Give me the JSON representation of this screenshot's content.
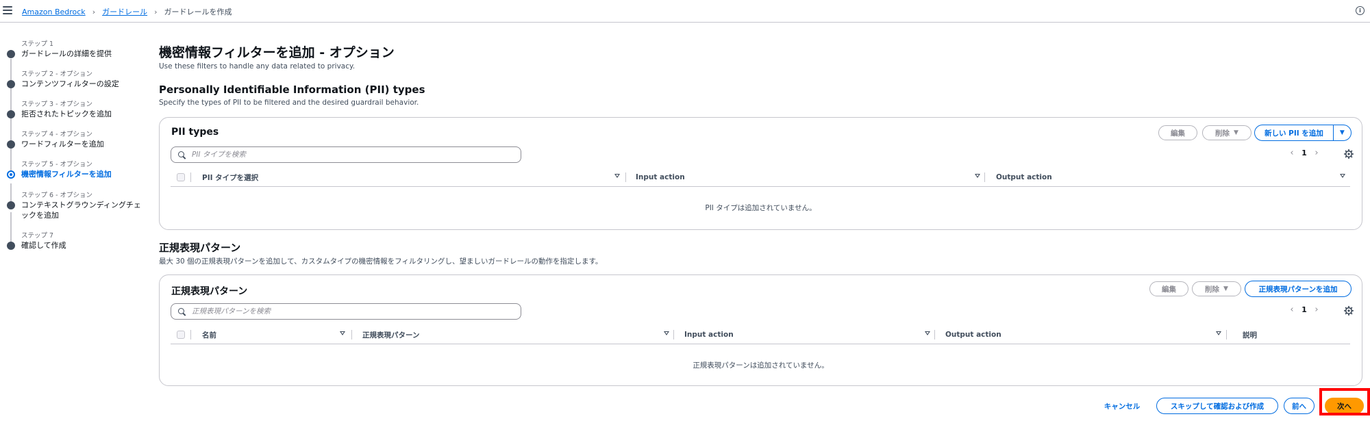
{
  "breadcrumb": {
    "items": [
      "Amazon Bedrock",
      "ガードレール"
    ],
    "current": "ガードレールを作成"
  },
  "steps": [
    {
      "num": "ステップ 1",
      "title": "ガードレールの詳細を提供",
      "active": false
    },
    {
      "num": "ステップ 2 - オプション",
      "title": "コンテンツフィルターの設定",
      "active": false
    },
    {
      "num": "ステップ 3 - オプション",
      "title": "拒否されたトピックを追加",
      "active": false
    },
    {
      "num": "ステップ 4 - オプション",
      "title": "ワードフィルターを追加",
      "active": false
    },
    {
      "num": "ステップ 5 - オプション",
      "title": "機密情報フィルターを追加",
      "active": true
    },
    {
      "num": "ステップ 6 - オプション",
      "title": "コンテキストグラウンディングチェックを追加",
      "active": false
    },
    {
      "num": "ステップ 7",
      "title": "確認して作成",
      "active": false
    }
  ],
  "main": {
    "title": "機密情報フィルターを追加 - オプション",
    "description": "Use these filters to handle any data related to privacy."
  },
  "pii": {
    "section_title": "Personally Identifiable Information (PII) types",
    "section_description": "Specify the types of PII to be filtered and the desired guardrail behavior.",
    "container_title": "PII types",
    "edit_label": "編集",
    "delete_label": "削除",
    "add_label": "新しい PII を追加",
    "search_placeholder": "PII タイプを検索",
    "page": "1",
    "columns": [
      "PII タイプを選択",
      "Input action",
      "Output action"
    ],
    "empty_text": "PII タイプは追加されていません。"
  },
  "regex": {
    "section_title": "正規表現パターン",
    "section_description": "最大 30 個の正規表現パターンを追加して、カスタムタイプの機密情報をフィルタリングし、望ましいガードレールの動作を指定します。",
    "container_title": "正規表現パターン",
    "edit_label": "編集",
    "delete_label": "削除",
    "add_label": "正規表現パターンを追加",
    "search_placeholder": "正規表現パターンを検索",
    "page": "1",
    "columns": [
      "名前",
      "正規表現パターン",
      "Input action",
      "Output action",
      "説明"
    ],
    "empty_text": "正規表現パターンは追加されていません。"
  },
  "footer": {
    "cancel": "キャンセル",
    "skip": "スキップして確認および作成",
    "prev": "前へ",
    "next": "次へ"
  },
  "colors": {
    "accent": "#006ce0",
    "primary_button": "#ff9900",
    "highlight": "#ff0000"
  }
}
